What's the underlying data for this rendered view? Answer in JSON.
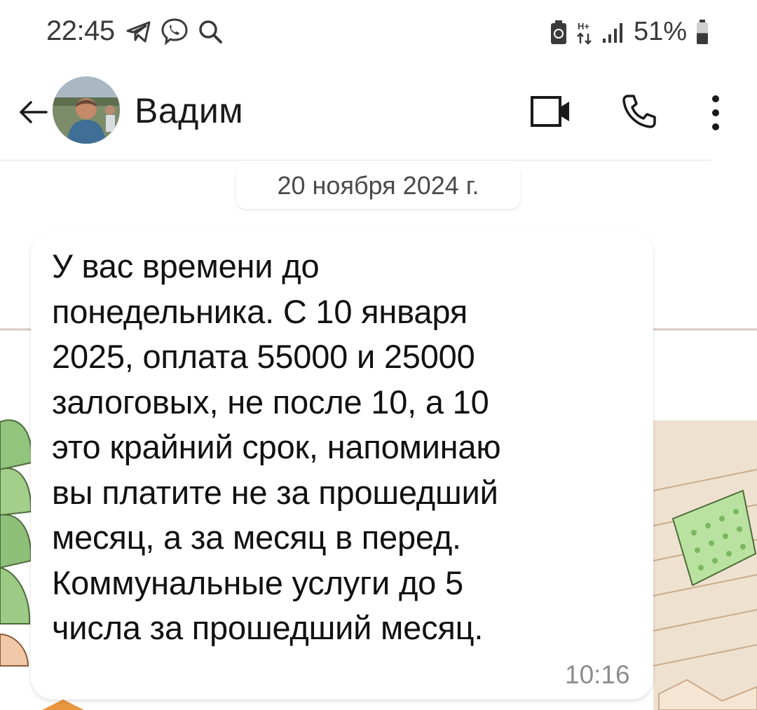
{
  "status_bar": {
    "time": "22:45",
    "battery_percent": "51%",
    "battery_level": 0.51,
    "icons_left": [
      "telegram-icon",
      "viber-icon",
      "search-icon"
    ],
    "icons_right": [
      "battery-saver-icon",
      "data-transfer-icon",
      "signal-icon",
      "battery-icon"
    ]
  },
  "header": {
    "contact_name": "Вадим",
    "actions": [
      "back-arrow-icon",
      "video-call-icon",
      "phone-icon",
      "more-vert-icon"
    ]
  },
  "chat": {
    "date_label": "20 ноября 2024 г.",
    "message": {
      "text": "У вас времени до\nпонедельника. С 10 января\n2025, оплата 55000 и 25000\nзалоговых, не после 10, а 10\nэто крайний срок, напоминаю\nвы платите не за прошедший\nмесяц, а за месяц в перед.\nКоммунальные услуги до 5\nчисла за прошедший месяц.",
      "time": "10:16"
    }
  },
  "colors": {
    "text": "#1a1a1a",
    "secondary_text": "#8c8c8c",
    "bubble": "#ffffff",
    "leaf_green": "#8fc07a",
    "roof_tan": "#e8d4bd"
  }
}
